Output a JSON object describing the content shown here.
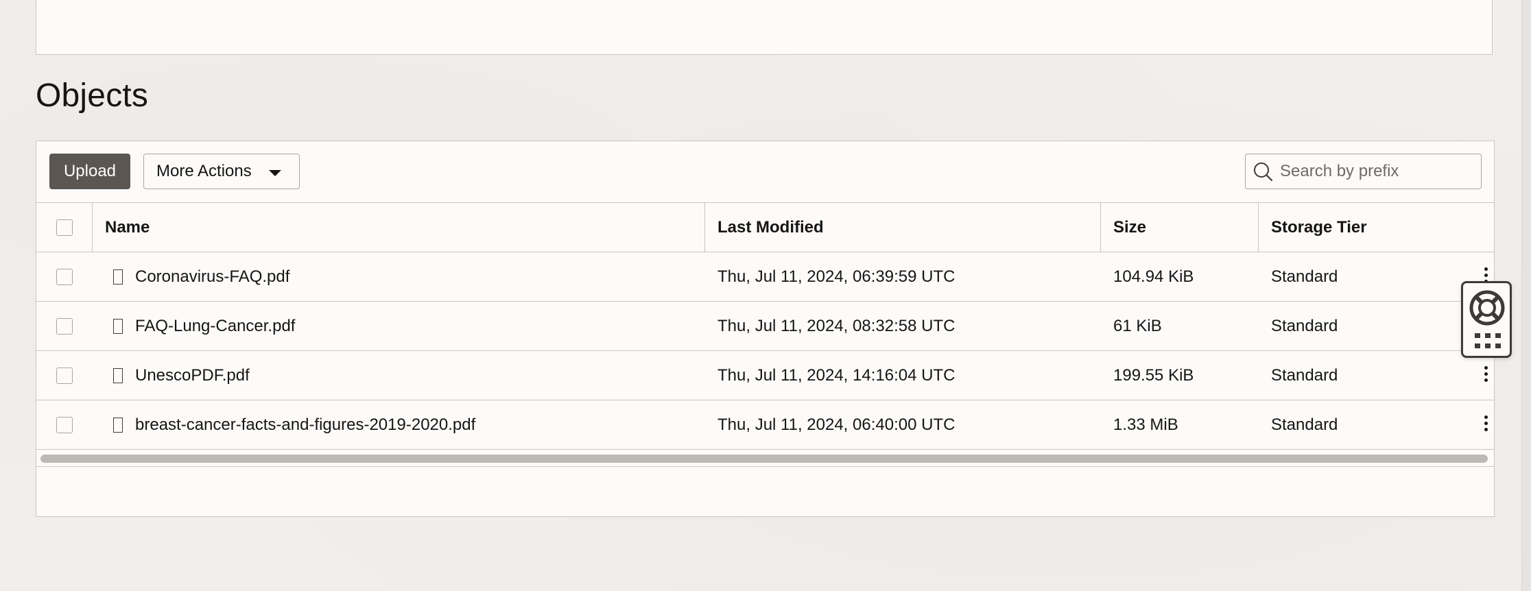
{
  "section": {
    "title": "Objects"
  },
  "toolbar": {
    "upload_label": "Upload",
    "more_actions_label": "More Actions",
    "search_placeholder": "Search by prefix",
    "search_value": ""
  },
  "table": {
    "columns": {
      "name": "Name",
      "last_modified": "Last Modified",
      "size": "Size",
      "storage_tier": "Storage Tier"
    },
    "rows": [
      {
        "name": "Coronavirus-FAQ.pdf",
        "last_modified": "Thu, Jul 11, 2024, 06:39:59 UTC",
        "size": "104.94 KiB",
        "storage_tier": "Standard"
      },
      {
        "name": "FAQ-Lung-Cancer.pdf",
        "last_modified": "Thu, Jul 11, 2024, 08:32:58 UTC",
        "size": "61 KiB",
        "storage_tier": "Standard"
      },
      {
        "name": "UnescoPDF.pdf",
        "last_modified": "Thu, Jul 11, 2024, 14:16:04 UTC",
        "size": "199.55 KiB",
        "storage_tier": "Standard"
      },
      {
        "name": "breast-cancer-facts-and-figures-2019-2020.pdf",
        "last_modified": "Thu, Jul 11, 2024, 06:40:00 UTC",
        "size": "1.33 MiB",
        "storage_tier": "Standard"
      }
    ]
  },
  "icons": {
    "search": "search-icon",
    "file": "file-icon",
    "row_actions": "kebab-menu-icon",
    "help": "lifebuoy-icon",
    "apps": "grid-icon",
    "dropdown": "caret-down-icon"
  },
  "colors": {
    "primary_button": "#5b5652",
    "background": "#f1efec",
    "panel": "#fcfbfa",
    "border": "#c9c6c1"
  }
}
